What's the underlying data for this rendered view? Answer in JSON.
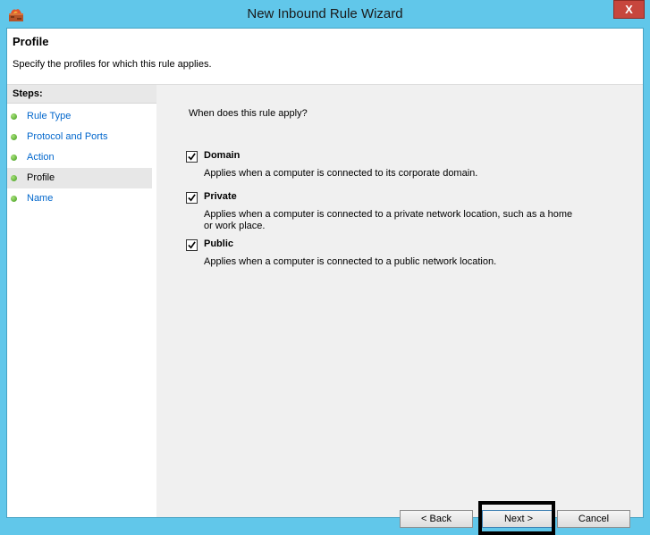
{
  "window": {
    "title": "New Inbound Rule Wizard",
    "close_glyph": "X"
  },
  "header": {
    "title": "Profile",
    "description": "Specify the profiles for which this rule applies."
  },
  "steps": {
    "heading": "Steps:",
    "items": [
      {
        "label": "Rule Type",
        "current": false
      },
      {
        "label": "Protocol and Ports",
        "current": false
      },
      {
        "label": "Action",
        "current": false
      },
      {
        "label": "Profile",
        "current": true
      },
      {
        "label": "Name",
        "current": false
      }
    ]
  },
  "main": {
    "question": "When does this rule apply?",
    "options": [
      {
        "name": "Domain",
        "checked": true,
        "description": "Applies when a computer is connected to its corporate domain."
      },
      {
        "name": "Private",
        "checked": true,
        "description": "Applies when a computer is connected to a private network location, such as a home or work place."
      },
      {
        "name": "Public",
        "checked": true,
        "description": "Applies when a computer is connected to a public network location."
      }
    ]
  },
  "buttons": {
    "back": "< Back",
    "next": "Next >",
    "cancel": "Cancel"
  },
  "colors": {
    "titlebar": "#61c7ea",
    "close": "#c7463d",
    "link": "#0066cc",
    "step_dot": "#3f9a1c"
  }
}
